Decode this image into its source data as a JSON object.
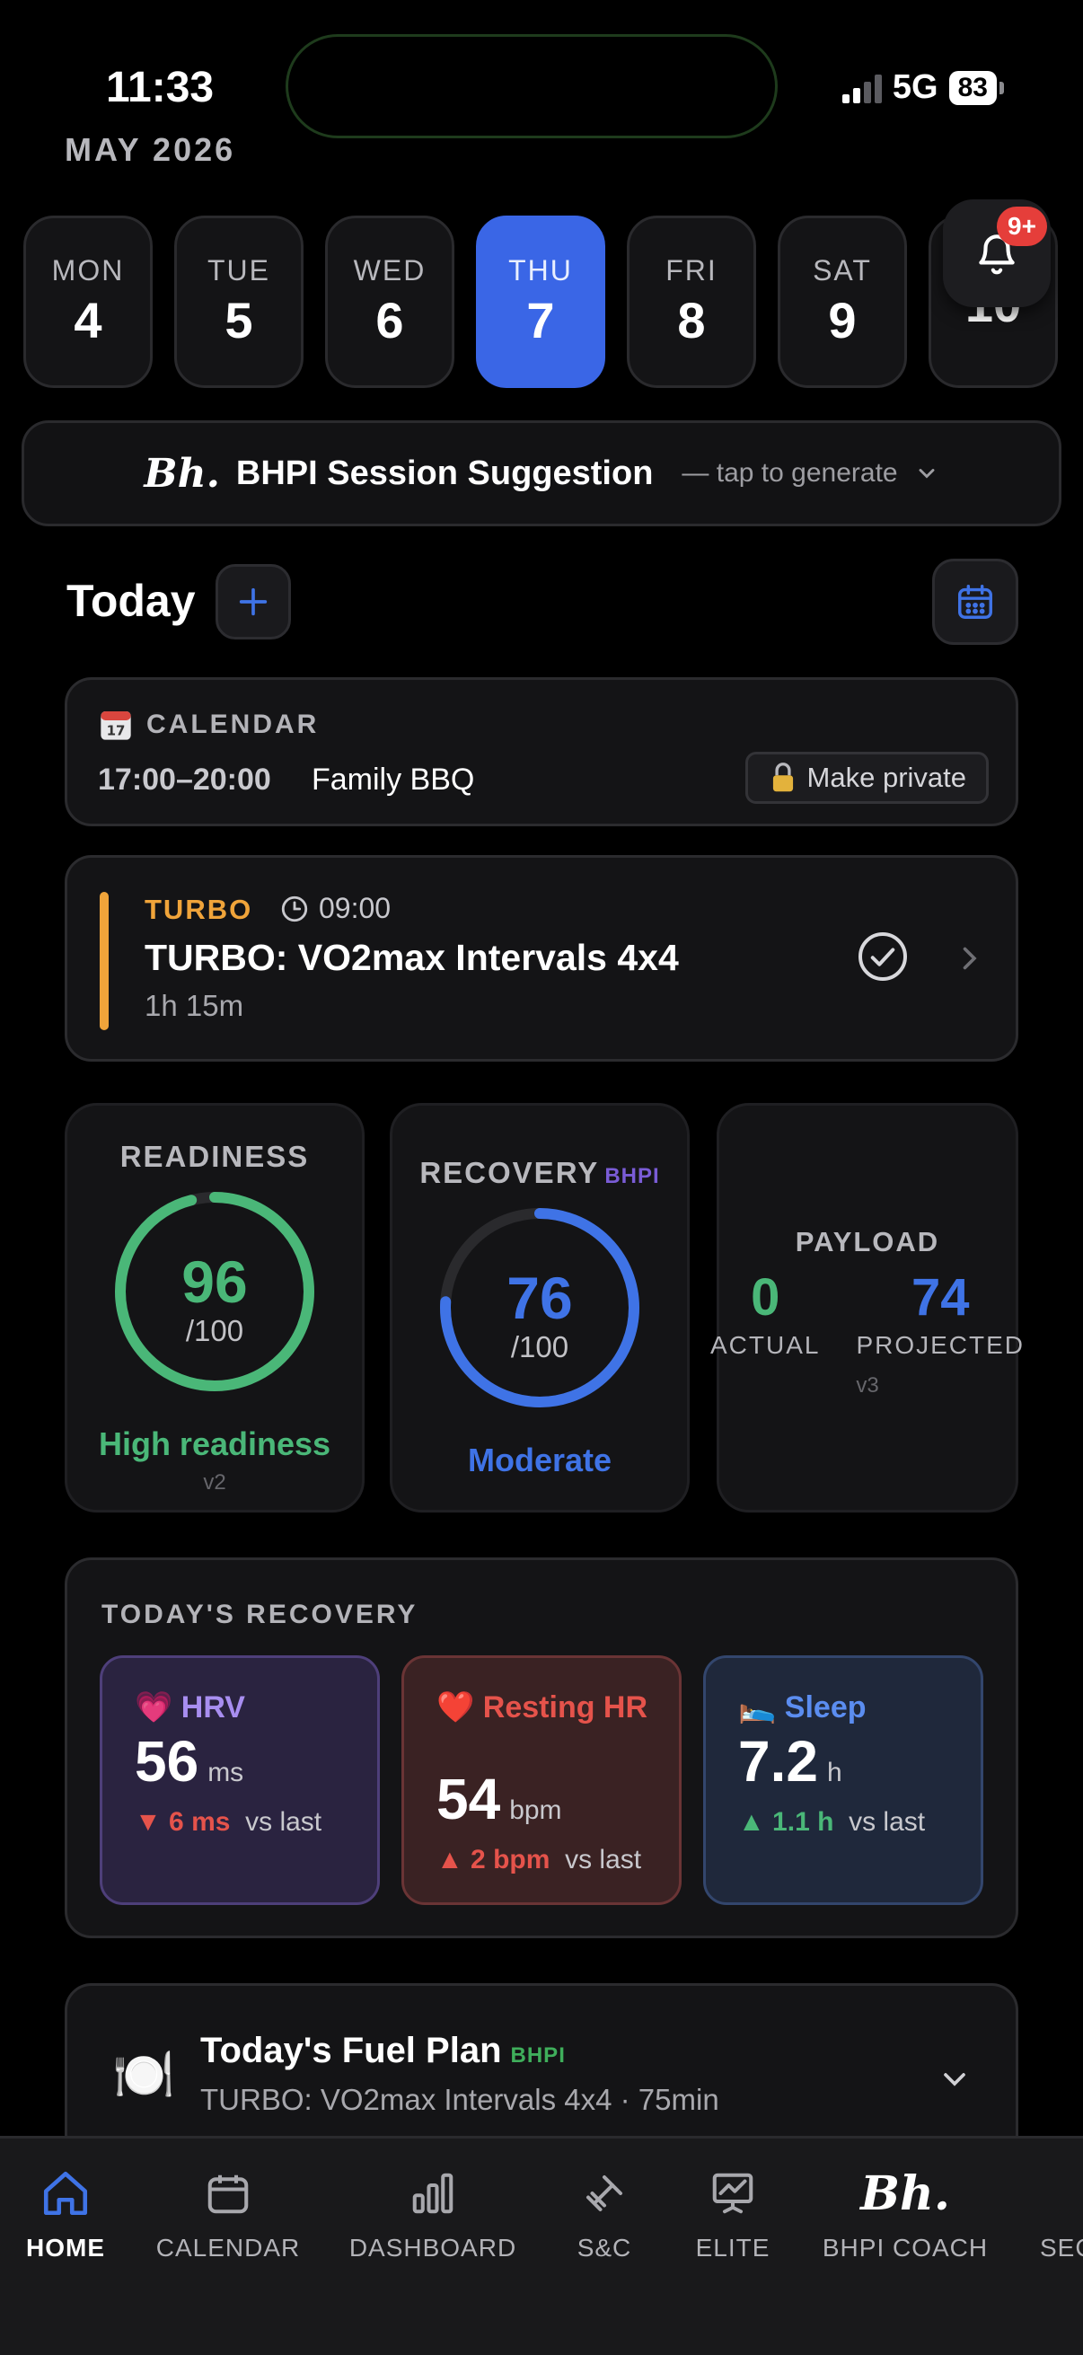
{
  "status": {
    "time": "11:33",
    "network": "5G",
    "battery": "83"
  },
  "header": {
    "month": "MAY 2026"
  },
  "week": [
    {
      "name": "MON",
      "date": "4"
    },
    {
      "name": "TUE",
      "date": "5"
    },
    {
      "name": "WED",
      "date": "6"
    },
    {
      "name": "THU",
      "date": "7",
      "selected": true
    },
    {
      "name": "FRI",
      "date": "8"
    },
    {
      "name": "SAT",
      "date": "9"
    },
    {
      "name": "",
      "date": "10"
    }
  ],
  "notifications": {
    "badge": "9+",
    "icon": "bell-icon"
  },
  "suggestion": {
    "logo": "Bh.",
    "title": "BHPI Session Suggestion",
    "hint": "— tap to generate"
  },
  "today": {
    "title": "Today"
  },
  "calendar_card": {
    "label": "CALENDAR",
    "icon": "calendar-emoji-icon",
    "time": "17:00–20:00",
    "event": "Family BBQ",
    "private_label": "Make private"
  },
  "session": {
    "tag": "TURBO",
    "time": "09:00",
    "title": "TURBO: VO2max Intervals 4x4",
    "duration": "1h 15m",
    "accent": "#f0a43a"
  },
  "readiness": {
    "label": "READINESS",
    "value": "96",
    "max": "/100",
    "fraction": 0.96,
    "status": "High readiness",
    "version": "v2",
    "color": "#4ab778"
  },
  "recovery": {
    "label": "RECOVERY",
    "tag": "BHPI",
    "value": "76",
    "max": "/100",
    "fraction": 0.76,
    "status": "Moderate",
    "color": "#3f73e6"
  },
  "payload": {
    "label": "PAYLOAD",
    "actual": "0",
    "actual_label": "ACTUAL",
    "projected": "74",
    "projected_label": "PROJECTED",
    "version": "v3"
  },
  "todays_recovery": {
    "title": "TODAY'S RECOVERY",
    "hrv": {
      "icon": "💗",
      "label": "HRV",
      "value": "56",
      "unit": "ms",
      "delta_arrow": "▼",
      "delta": "6 ms",
      "delta_suffix": "vs last"
    },
    "rhr": {
      "icon": "❤️",
      "label": "Resting HR",
      "value": "54",
      "unit": "bpm",
      "delta_arrow": "▲",
      "delta": "2 bpm",
      "delta_suffix": "vs last"
    },
    "sleep": {
      "icon": "🛌",
      "label": "Sleep",
      "value": "7.2",
      "unit": "h",
      "delta_arrow": "▲",
      "delta": "1.1 h",
      "delta_suffix": "vs last"
    }
  },
  "fuel": {
    "icon": "🍽️",
    "title": "Today's Fuel Plan",
    "tag": "BHPI",
    "subtitle": "TURBO: VO2max Intervals 4x4 · 75min"
  },
  "tabs": [
    {
      "label": "HOME",
      "icon": "home-icon",
      "active": true
    },
    {
      "label": "CALENDAR",
      "icon": "calendar-icon"
    },
    {
      "label": "DASHBOARD",
      "icon": "bar-chart-icon"
    },
    {
      "label": "S&C",
      "icon": "dumbbell-icon"
    },
    {
      "label": "ELITE",
      "icon": "presentation-chart-icon"
    },
    {
      "label": "BHPI COACH",
      "icon": "bhpi-logo-icon",
      "logo": "Bh."
    },
    {
      "label": "SEC",
      "icon": ""
    }
  ]
}
